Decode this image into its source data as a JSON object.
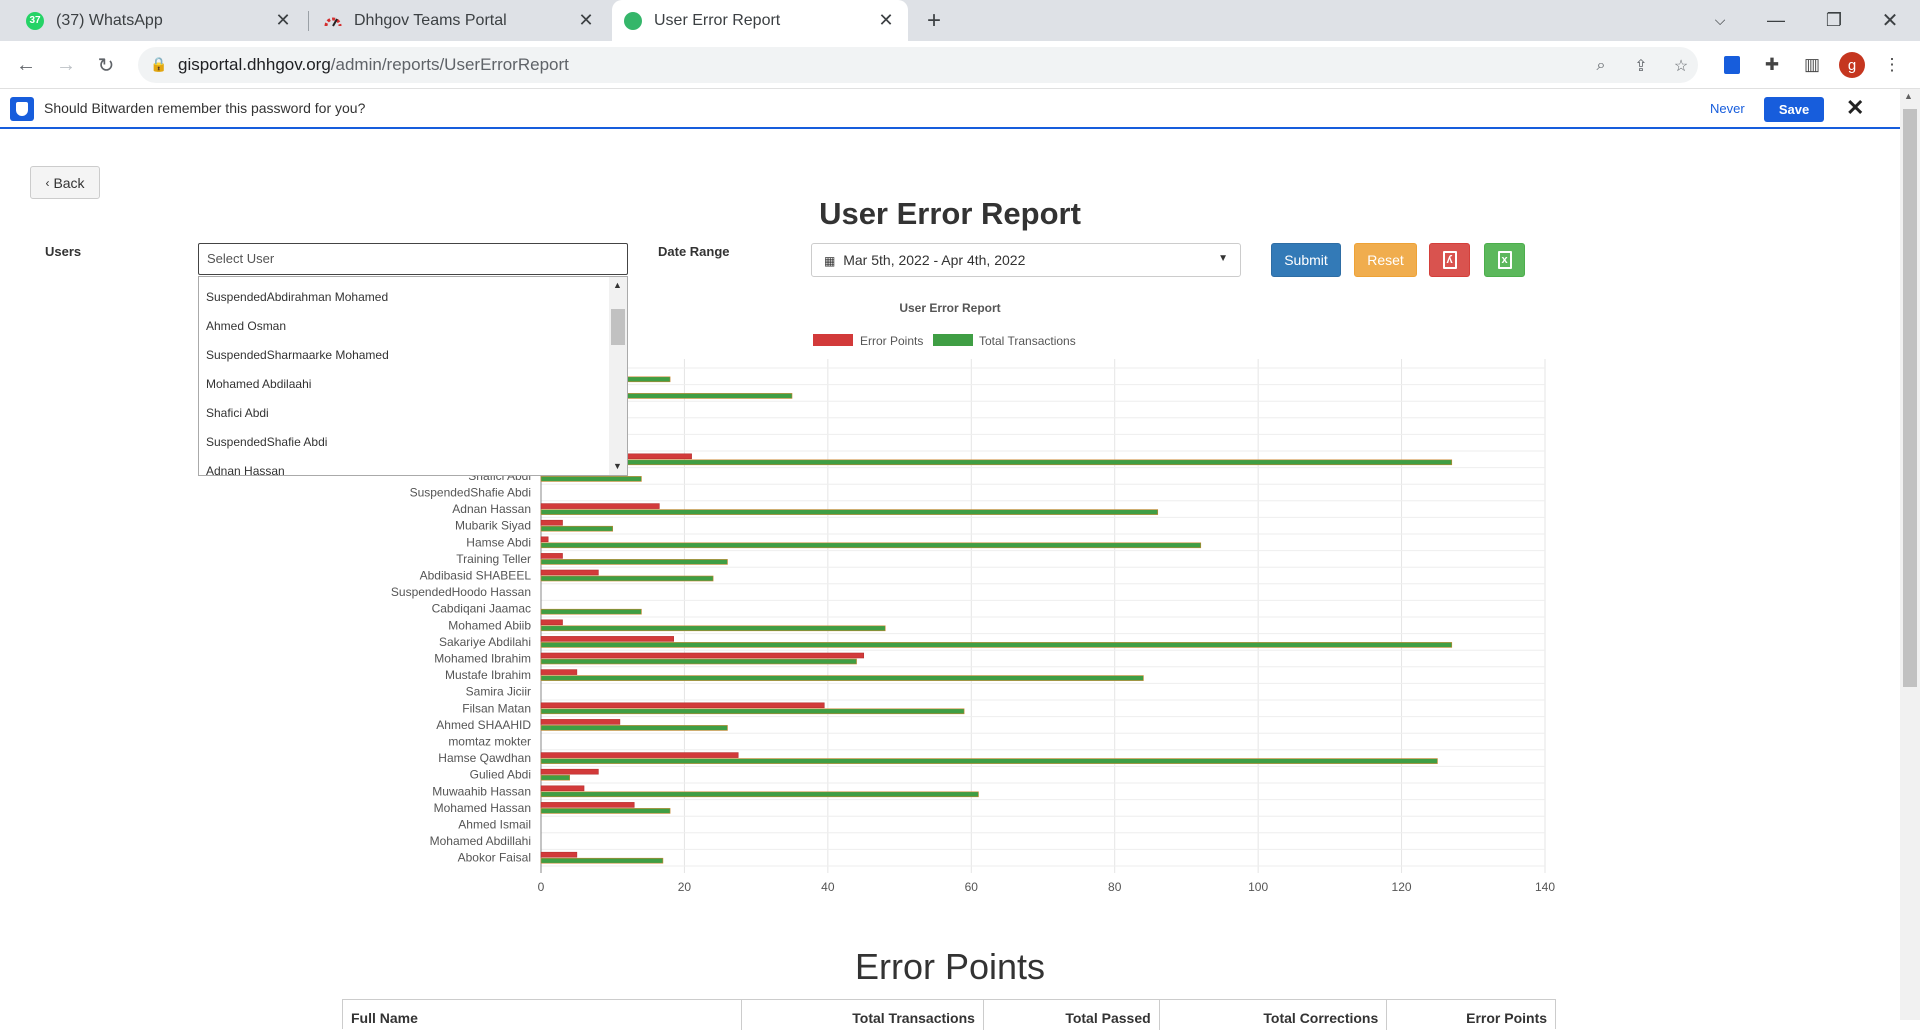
{
  "browser": {
    "tabs": [
      {
        "title": "(37) WhatsApp",
        "badge": "37"
      },
      {
        "title": "Dhhgov Teams Portal"
      },
      {
        "title": "User Error Report"
      }
    ],
    "url_domain": "gisportal.dhhgov.org",
    "url_path": "/admin/reports/UserErrorReport",
    "profile_initial": "g"
  },
  "bitwarden": {
    "message": "Should Bitwarden remember this password for you?",
    "never_label": "Never",
    "save_label": "Save"
  },
  "page": {
    "back_label": "Back",
    "title": "User Error Report",
    "users_label": "Users",
    "user_placeholder": "Select User",
    "date_range_label": "Date Range",
    "date_range_value": "Mar 5th, 2022 - Apr 4th, 2022",
    "submit_label": "Submit",
    "reset_label": "Reset"
  },
  "dropdown_options": [
    "SuspendedAbdirahman Mohamed",
    "Ahmed Osman",
    "SuspendedSharmaarke Mohamed",
    "Mohamed Abdilaahi",
    "Shafici Abdi",
    "SuspendedShafie Abdi",
    "Adnan Hassan"
  ],
  "chart_data": {
    "type": "bar",
    "orientation": "horizontal",
    "title": "User Error Report",
    "xlim": [
      0,
      140
    ],
    "xticks": [
      0,
      20,
      40,
      60,
      80,
      100,
      120,
      140
    ],
    "legend_position": "top",
    "grid": true,
    "categories": [
      "",
      "",
      "",
      "",
      "",
      "",
      "Shafici Abdi",
      "SuspendedShafie Abdi",
      "Adnan Hassan",
      "Mubarik Siyad",
      "Hamse Abdi",
      "Training Teller",
      "Abdibasid SHABEEL",
      "SuspendedHoodo Hassan",
      "Cabdiqani Jaamac",
      "Mohamed Abiib",
      "Sakariye Abdilahi",
      "Mohamed Ibrahim",
      "Mustafe Ibrahim",
      "Samira Jiciir",
      "Filsan Matan",
      "Ahmed SHAAHID",
      "momtaz mokter",
      "Hamse Qawdhan",
      "Gulied Abdi",
      "Muwaahib Hassan",
      "Mohamed Hassan",
      "Ahmed Ismail",
      "Mohamed Abdillahi",
      "Abokor Faisal"
    ],
    "series": [
      {
        "name": "Error Points",
        "color": "#d23a3a",
        "values": [
          0,
          0,
          0,
          0,
          0,
          21,
          2,
          0,
          16.5,
          3,
          1,
          3,
          8,
          0,
          0,
          3,
          18.5,
          45,
          5,
          0,
          39.5,
          11,
          0,
          27.5,
          8,
          6,
          13,
          0,
          0,
          5
        ]
      },
      {
        "name": "Total Transactions",
        "color": "#3f9e44",
        "values": [
          18,
          35,
          0,
          0,
          0,
          127,
          14,
          0,
          86,
          10,
          92,
          26,
          24,
          0,
          14,
          48,
          127,
          44,
          84,
          0,
          59,
          26,
          0,
          125,
          4,
          61,
          18,
          0,
          0,
          17
        ]
      }
    ]
  },
  "error_points": {
    "title": "Error Points",
    "columns": [
      "Full Name",
      "Total Transactions",
      "Total Passed",
      "Total Corrections",
      "Error Points"
    ]
  },
  "colors": {
    "bitwarden": "#175ddc",
    "submit": "#337ab7",
    "reset": "#f0ad4e",
    "pdf": "#d9534f",
    "excel": "#5cb85c"
  }
}
